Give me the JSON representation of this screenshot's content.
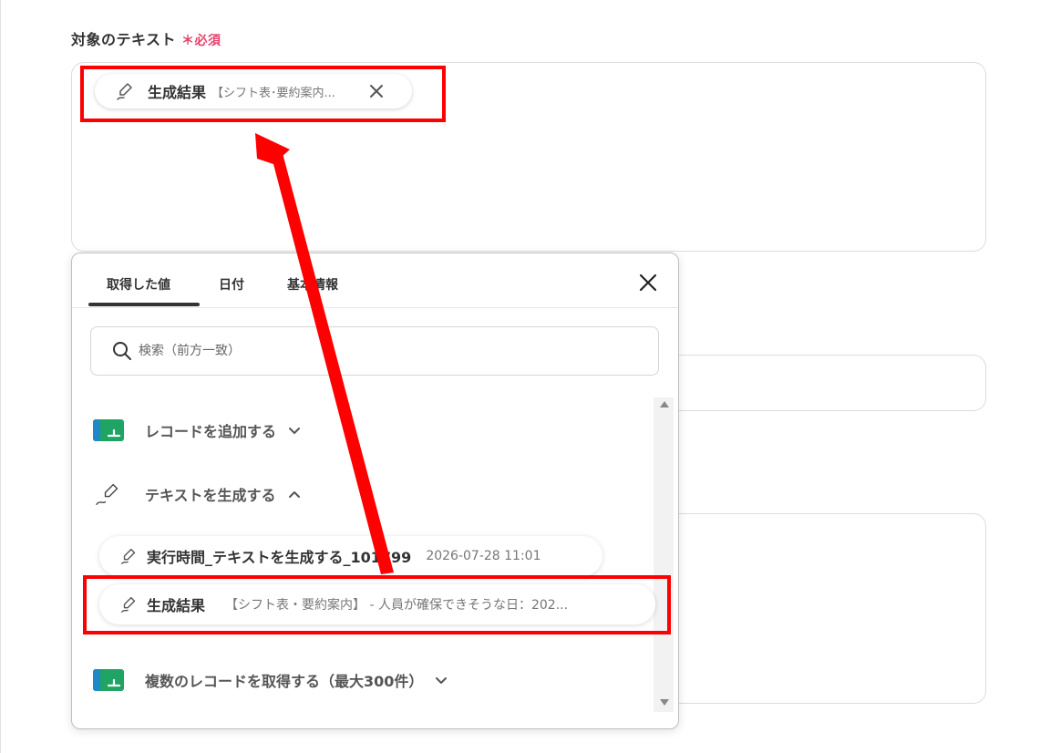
{
  "field": {
    "label": "対象のテキスト",
    "required_mark": "＊必須"
  },
  "selected_chip": {
    "title": "生成結果",
    "preview": "【シフト表･要約案内..."
  },
  "popup": {
    "tabs": [
      {
        "label": "取得した値",
        "active": true
      },
      {
        "label": "日付",
        "active": false
      },
      {
        "label": "基本情報",
        "active": false
      }
    ],
    "search": {
      "placeholder": "検索（前方一致）"
    },
    "groups": [
      {
        "label": "レコードを追加する",
        "icon": "sheet-icon",
        "expanded": false
      },
      {
        "label": "テキストを生成する",
        "icon": "pen-icon",
        "expanded": true
      },
      {
        "label": "複数のレコードを取得する（最大300件）",
        "icon": "sheet-icon",
        "expanded": false
      }
    ],
    "items": [
      {
        "title": "実行時間_テキストを生成する_101799",
        "sub": "2026-07-28 11:01"
      },
      {
        "title": "生成結果",
        "sub": "【シフト表・要約案内】 - 人員が確保できそうな日：202..."
      }
    ]
  },
  "colors": {
    "required": "#e8416d",
    "annotation": "#ff0000",
    "sheet_green": "#1fa463",
    "sheet_blue": "#1e88c8"
  }
}
